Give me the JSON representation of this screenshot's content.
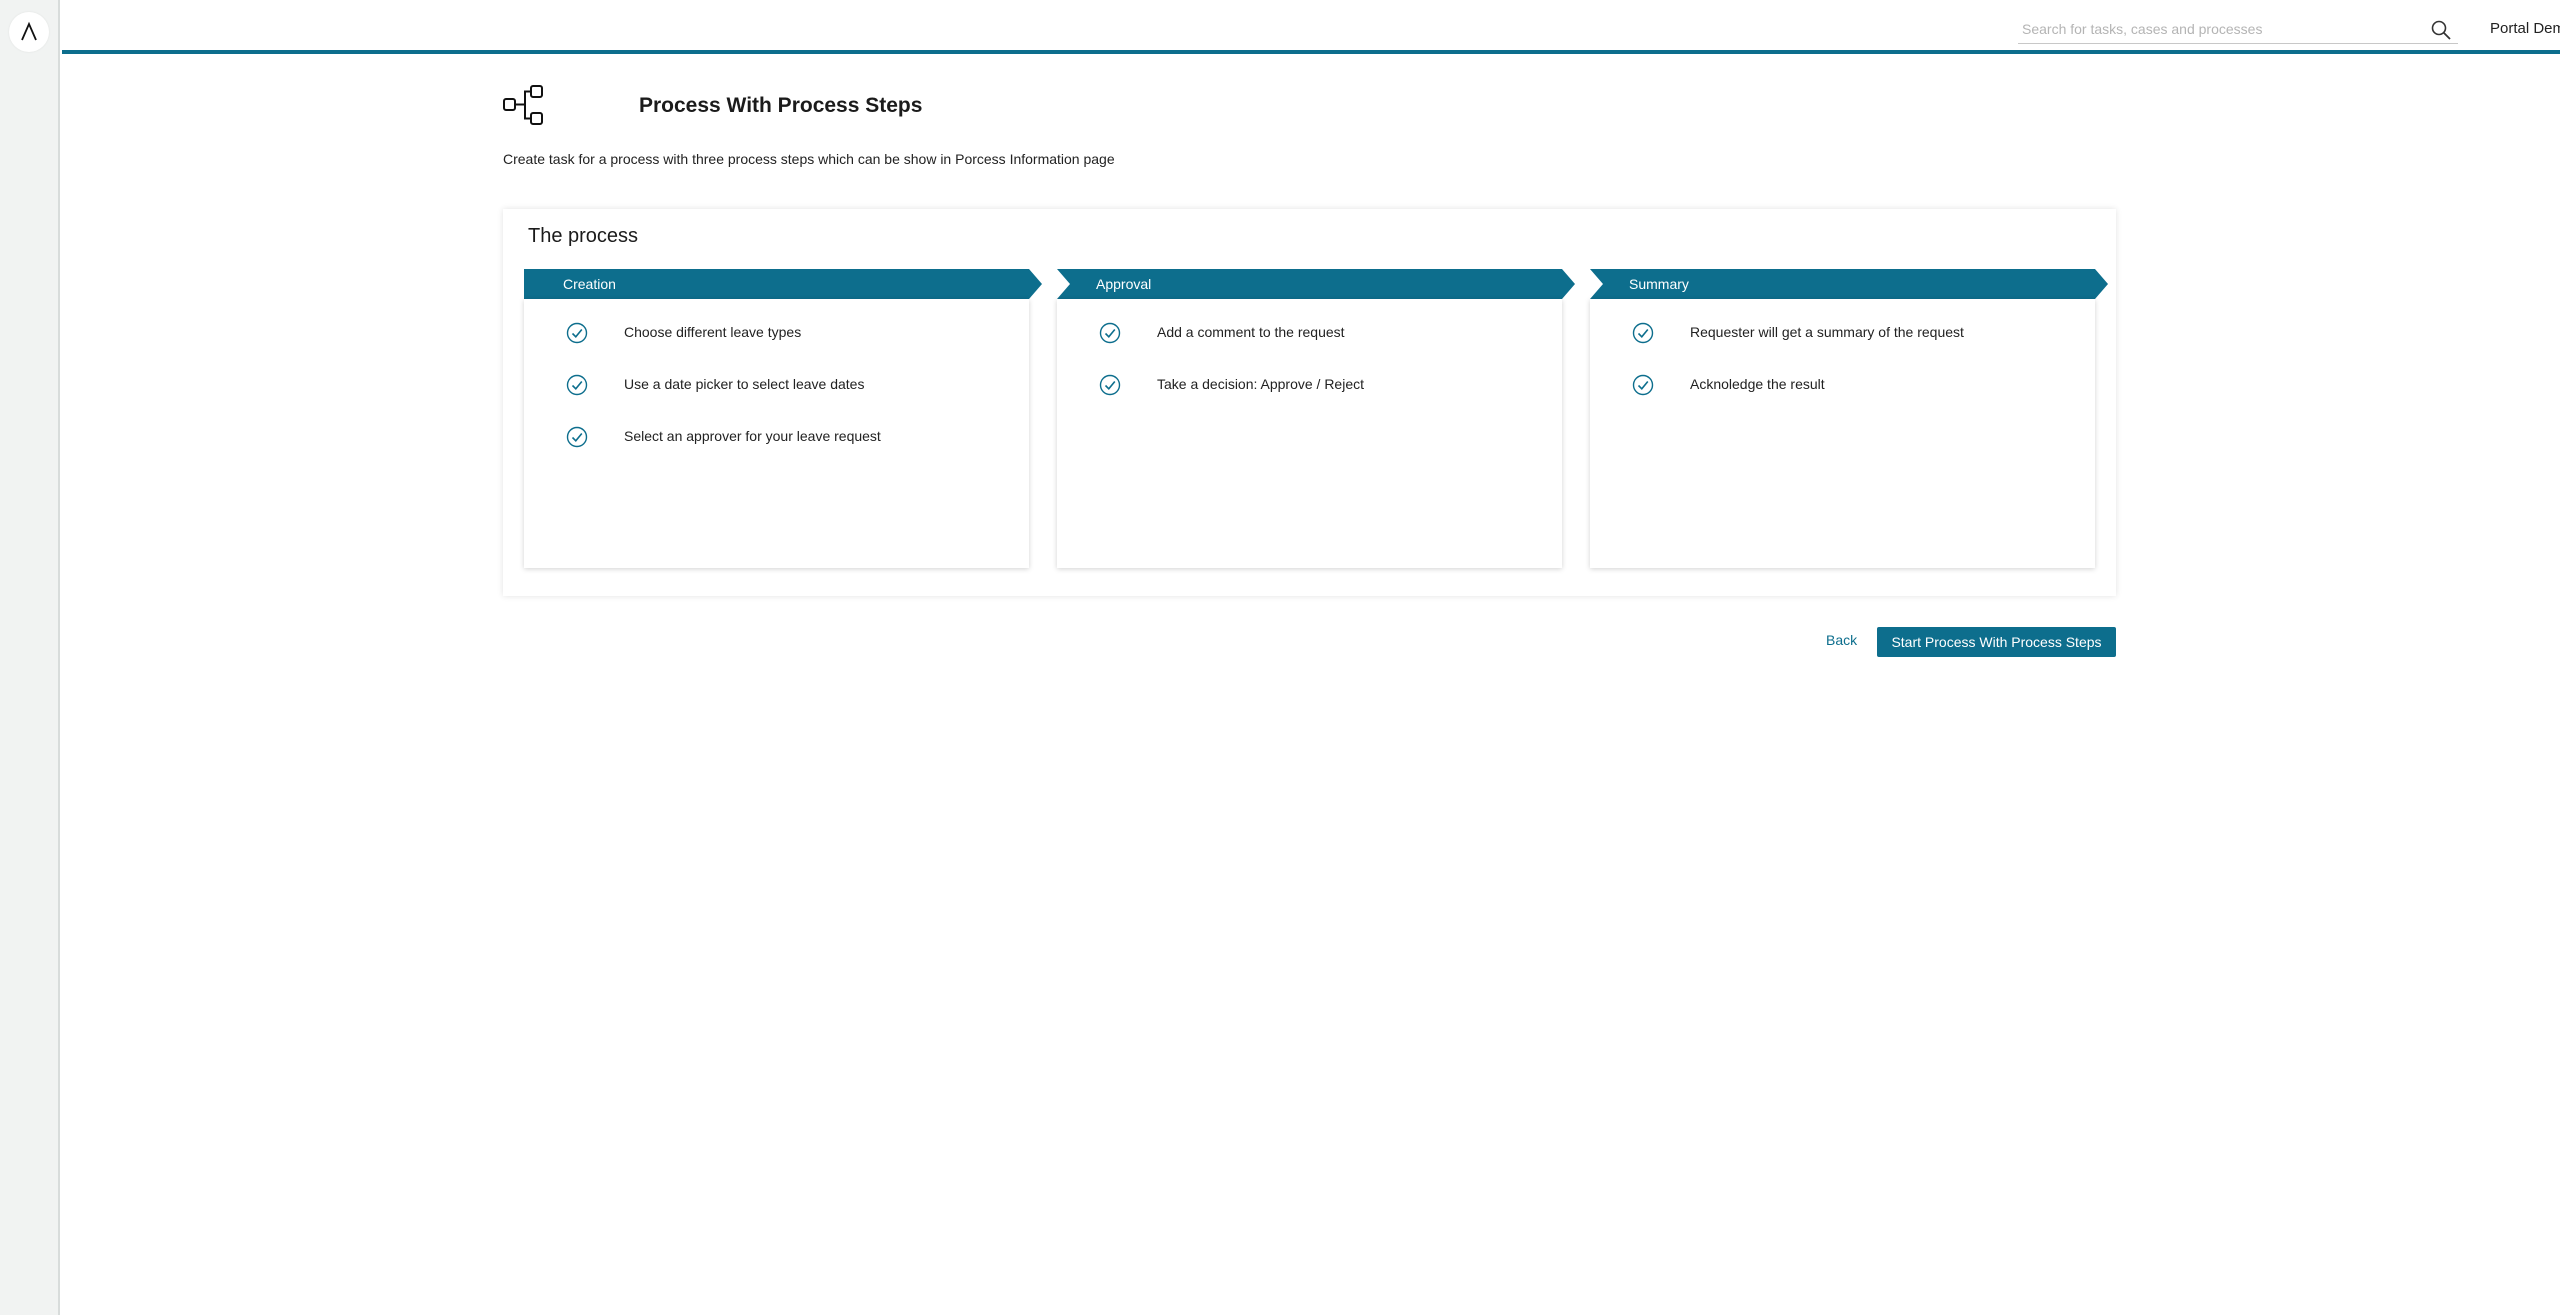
{
  "app": {
    "logo_icon": "ivy-lambda-logo-icon"
  },
  "topbar": {
    "search": {
      "placeholder": "Search for tasks, cases and processes",
      "value": ""
    },
    "user_name": "Portal Demo User"
  },
  "page": {
    "title": "Process With Process Steps",
    "description": "Create task for a process with three process steps which can be show in Porcess Information page"
  },
  "process_card": {
    "title": "The process",
    "steps": [
      {
        "label": "Creation",
        "items": [
          "Choose different leave types",
          "Use a date picker to select leave dates",
          "Select an approver for your leave request"
        ]
      },
      {
        "label": "Approval",
        "items": [
          "Add a comment to the request",
          "Take a decision: Approve / Reject"
        ]
      },
      {
        "label": "Summary",
        "items": [
          "Requester will get a summary of the request",
          "Acknoledge the result"
        ]
      }
    ]
  },
  "actions": {
    "back_label": "Back",
    "start_label": "Start Process With Process Steps"
  },
  "colors": {
    "accent": "#0d6e8d",
    "sidebar_bg": "#f1f3f2"
  }
}
